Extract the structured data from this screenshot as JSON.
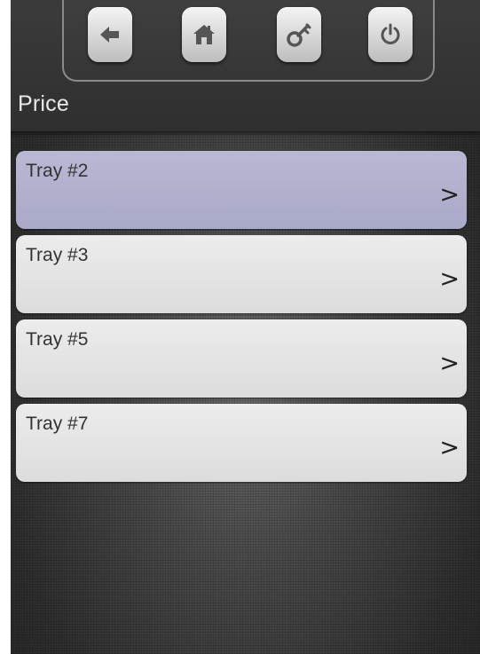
{
  "header": {
    "title": "Price",
    "toolbar": {
      "buttons": [
        {
          "name": "back-button",
          "icon": "back-arrow-icon"
        },
        {
          "name": "home-button",
          "icon": "home-icon"
        },
        {
          "name": "key-button",
          "icon": "key-icon"
        },
        {
          "name": "power-button",
          "icon": "power-icon"
        }
      ]
    }
  },
  "list": {
    "selected_index": 0,
    "chevron": ">",
    "items": [
      {
        "label": "Tray #2"
      },
      {
        "label": "Tray #3"
      },
      {
        "label": "Tray #5"
      },
      {
        "label": "Tray #7"
      }
    ]
  },
  "colors": {
    "selected_item": "#b1b1cd",
    "item": "#e4e4e4",
    "header": "#353535",
    "icon": "#555555"
  }
}
